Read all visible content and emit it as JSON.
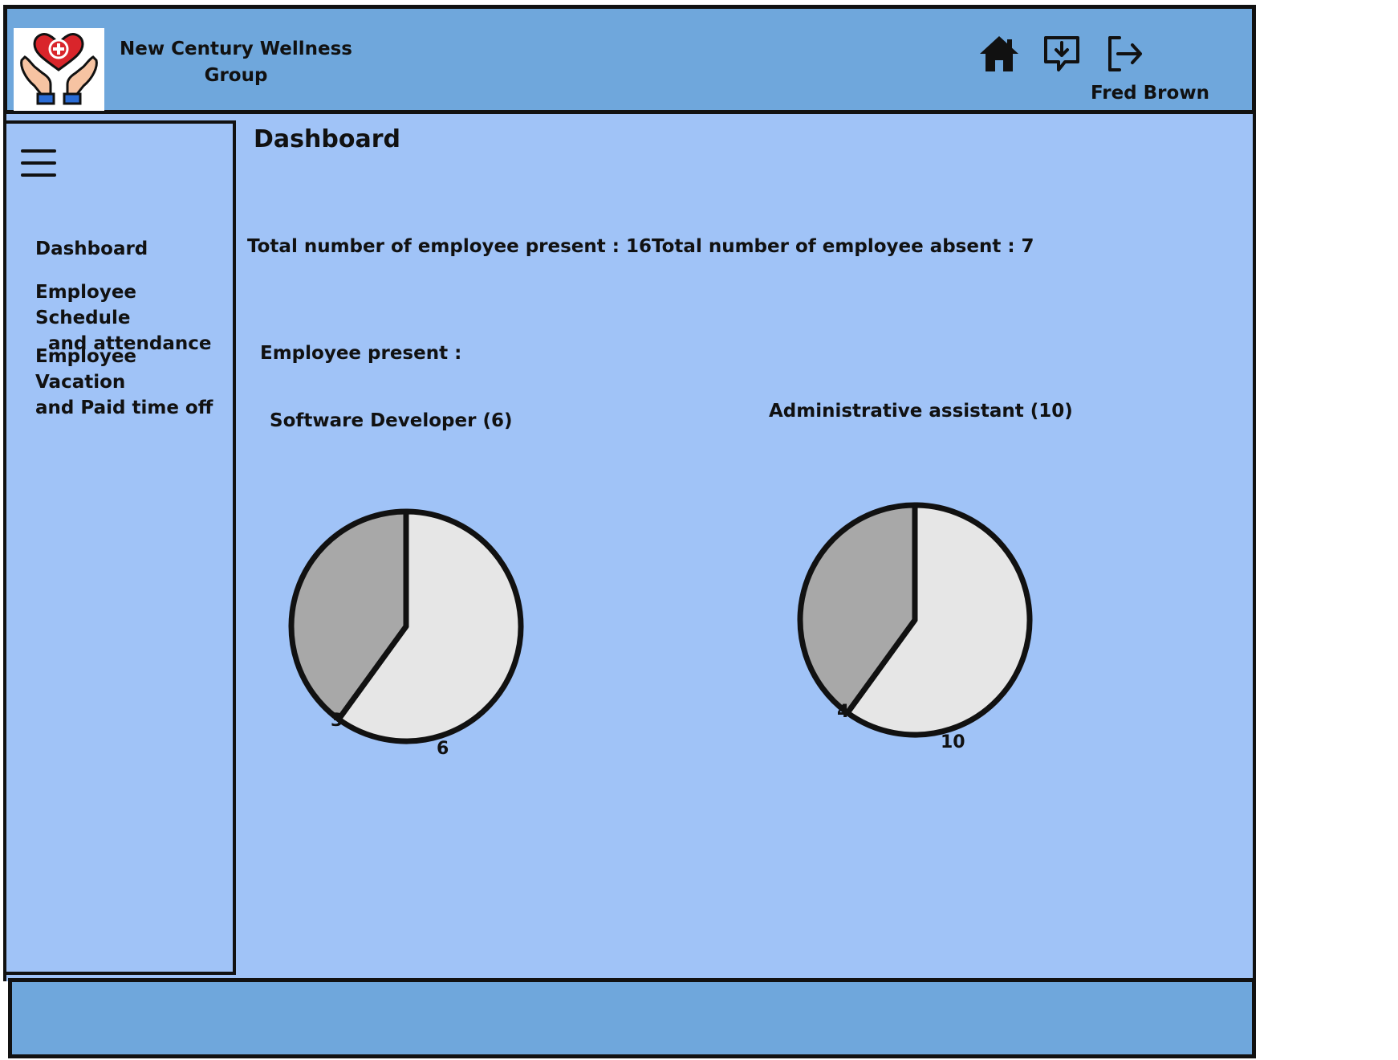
{
  "header": {
    "brand_line1": "New Century Wellness",
    "brand_line2": "Group",
    "user_name": "Fred Brown",
    "icons": [
      "home-icon",
      "download-message-icon",
      "logout-icon"
    ]
  },
  "sidebar": {
    "items": [
      {
        "line1": "Dashboard",
        "line2": ""
      },
      {
        "line1": "Employee Schedule",
        "line2": "and attendance"
      },
      {
        "line1": "Employee Vacation",
        "line2": "and Paid time off"
      }
    ]
  },
  "main": {
    "title": "Dashboard",
    "present_text": "Total number of employee present : 16",
    "absent_text": "Total number of employee absent : 7",
    "section_label": "Employee present :"
  },
  "colors": {
    "header_bg": "#6fa7dc",
    "main_bg": "#a0c3f7",
    "pie_light": "#e6e6e6",
    "pie_dark": "#a8a8a8"
  },
  "chart_data": [
    {
      "type": "pie",
      "title": "Software Developer (6)",
      "slices": [
        {
          "label": "6",
          "value": 6,
          "color": "#e6e6e6"
        },
        {
          "label": "3",
          "value": 4,
          "color": "#a8a8a8"
        }
      ]
    },
    {
      "type": "pie",
      "title": "Administrative assistant  (10)",
      "slices": [
        {
          "label": "10",
          "value": 6,
          "color": "#e6e6e6"
        },
        {
          "label": "4",
          "value": 4,
          "color": "#a8a8a8"
        }
      ]
    }
  ]
}
